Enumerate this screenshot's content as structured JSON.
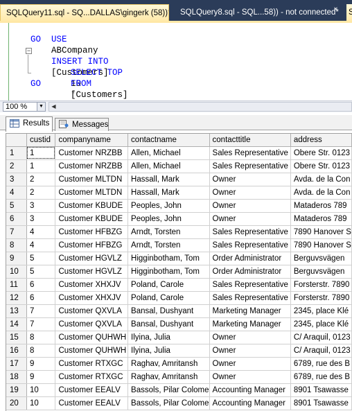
{
  "tabs": {
    "active": "SQLQuery11.sql - SQ...DALLAS\\gingerk (58))*",
    "inactive": "SQLQuery8.sql - SQL...58)) - not connected*",
    "close": "×",
    "overflow": "S"
  },
  "editor": {
    "lines": [
      "USE ABCompany",
      "GO",
      "INSERT INTO [Customers]",
      "SELECT TOP 10 *",
      "FROM [Customers]",
      "GO"
    ]
  },
  "zoom": {
    "value": "100 %"
  },
  "results": {
    "tab_results": "Results",
    "tab_messages": "Messages",
    "columns": [
      "custid",
      "companyname",
      "contactname",
      "contacttitle",
      "address"
    ],
    "rows": [
      [
        "1",
        "Customer NRZBB",
        "Allen, Michael",
        "Sales Representative",
        "Obere Str. 0123"
      ],
      [
        "1",
        "Customer NRZBB",
        "Allen, Michael",
        "Sales Representative",
        "Obere Str. 0123"
      ],
      [
        "2",
        "Customer MLTDN",
        "Hassall, Mark",
        "Owner",
        "Avda. de la Con"
      ],
      [
        "2",
        "Customer MLTDN",
        "Hassall, Mark",
        "Owner",
        "Avda. de la Con"
      ],
      [
        "3",
        "Customer KBUDE",
        "Peoples, John",
        "Owner",
        "Mataderos  789"
      ],
      [
        "3",
        "Customer KBUDE",
        "Peoples, John",
        "Owner",
        "Mataderos  789"
      ],
      [
        "4",
        "Customer HFBZG",
        "Arndt, Torsten",
        "Sales Representative",
        "7890 Hanover S"
      ],
      [
        "4",
        "Customer HFBZG",
        "Arndt, Torsten",
        "Sales Representative",
        "7890 Hanover S"
      ],
      [
        "5",
        "Customer HGVLZ",
        "Higginbotham, Tom",
        "Order Administrator",
        "Berguvsvägen"
      ],
      [
        "5",
        "Customer HGVLZ",
        "Higginbotham, Tom",
        "Order Administrator",
        "Berguvsvägen"
      ],
      [
        "6",
        "Customer XHXJV",
        "Poland, Carole",
        "Sales Representative",
        "Forsterstr. 7890"
      ],
      [
        "6",
        "Customer XHXJV",
        "Poland, Carole",
        "Sales Representative",
        "Forsterstr. 7890"
      ],
      [
        "7",
        "Customer QXVLA",
        "Bansal, Dushyant",
        "Marketing Manager",
        "2345, place Klé"
      ],
      [
        "7",
        "Customer QXVLA",
        "Bansal, Dushyant",
        "Marketing Manager",
        "2345, place Klé"
      ],
      [
        "8",
        "Customer QUHWH",
        "Ilyina, Julia",
        "Owner",
        "C/ Araquil, 0123"
      ],
      [
        "8",
        "Customer QUHWH",
        "Ilyina, Julia",
        "Owner",
        "C/ Araquil, 0123"
      ],
      [
        "9",
        "Customer RTXGC",
        "Raghav, Amritansh",
        "Owner",
        "6789, rue des B"
      ],
      [
        "9",
        "Customer RTXGC",
        "Raghav, Amritansh",
        "Owner",
        "6789, rue des B"
      ],
      [
        "10",
        "Customer EEALV",
        "Bassols, Pilar Colome",
        "Accounting Manager",
        "8901 Tsawasse"
      ],
      [
        "10",
        "Customer EEALV",
        "Bassols, Pilar Colome",
        "Accounting Manager",
        "8901 Tsawasse"
      ]
    ]
  }
}
